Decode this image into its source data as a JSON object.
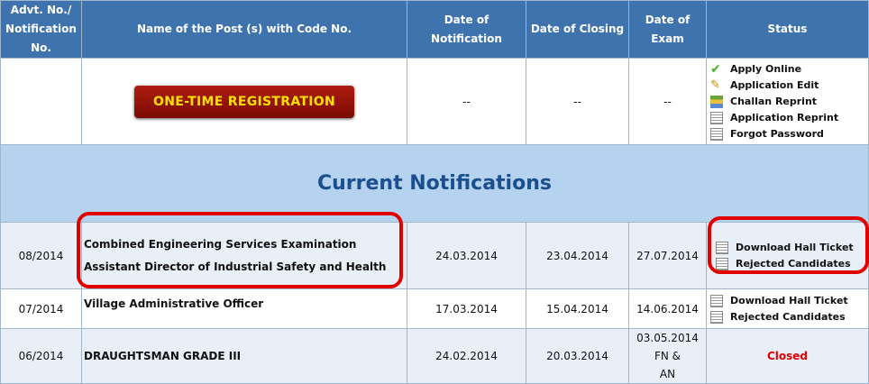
{
  "headers": {
    "advt_line1": "Advt. No./",
    "advt_line2": "Notification No.",
    "name": "Name of the Post (s) with Code No.",
    "date_notification": "Date of Notification",
    "date_closing": "Date of Closing",
    "date_exam": "Date of Exam",
    "status": "Status"
  },
  "otr": {
    "button_label": "ONE-TIME REGISTRATION",
    "date_notification": "--",
    "date_closing": "--",
    "date_exam": "--",
    "links": [
      {
        "label": "Apply Online",
        "icon": "check-icon"
      },
      {
        "label": "Application Edit",
        "icon": "pencil-icon"
      },
      {
        "label": "Challan Reprint",
        "icon": "challan-icon"
      },
      {
        "label": "Application Reprint",
        "icon": "notepad-icon"
      },
      {
        "label": "Forgot Password",
        "icon": "notepad-icon"
      }
    ]
  },
  "section_title": "Current Notifications",
  "rows": [
    {
      "advt": "08/2014",
      "posts": [
        "Combined Engineering Services Examination",
        "Assistant Director of Industrial Safety and Health"
      ],
      "date_notification": "24.03.2014",
      "date_closing": "23.04.2014",
      "date_exam": "27.07.2014",
      "links": [
        "Download Hall Ticket",
        "Rejected Candidates"
      ]
    },
    {
      "advt": "07/2014",
      "posts": [
        "Village Administrative Officer"
      ],
      "date_notification": "17.03.2014",
      "date_closing": "15.04.2014",
      "date_exam": "14.06.2014",
      "links": [
        "Download Hall Ticket",
        "Rejected Candidates"
      ]
    },
    {
      "advt": "06/2014",
      "posts": [
        "DRAUGHTSMAN GRADE III"
      ],
      "date_notification": "24.02.2014",
      "date_closing": "20.03.2014",
      "date_exam_line1": "03.05.2014 FN &",
      "date_exam_line2": "AN",
      "status": "Closed"
    }
  ],
  "colors": {
    "header_bg": "#3f73ad",
    "highlight": "#e00000",
    "section_bg": "#b5d2ee"
  }
}
